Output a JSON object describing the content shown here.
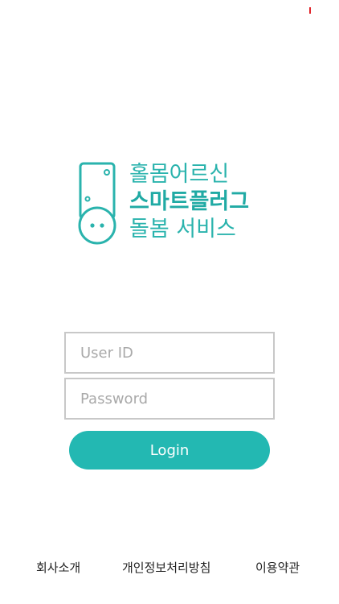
{
  "logo": {
    "line1": "홀몸어르신",
    "line2": "스마트플러그",
    "line3": "돌봄 서비스",
    "icon": "smart-plug-icon",
    "color": "#2ab3ad"
  },
  "login": {
    "userid_placeholder": "User ID",
    "userid_value": "",
    "password_placeholder": "Password",
    "password_value": "",
    "button_label": "Login",
    "button_color": "#23b8b2"
  },
  "footer": {
    "company": "회사소개",
    "privacy": "개인정보처리방침",
    "terms": "이용약관"
  }
}
